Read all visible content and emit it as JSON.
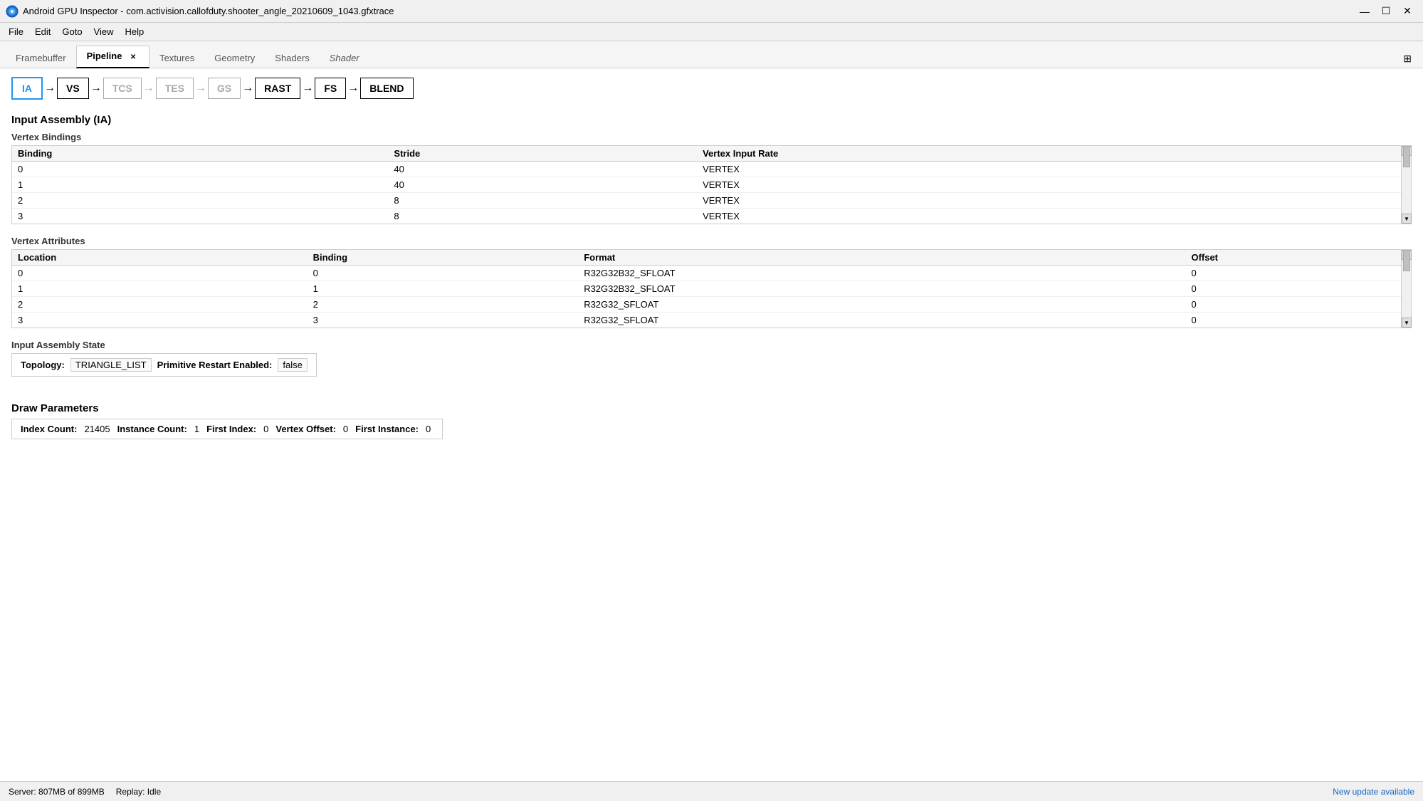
{
  "titleBar": {
    "title": "Android GPU Inspector - com.activision.callofduty.shooter_angle_20210609_1043.gfxtrace",
    "minimizeLabel": "—",
    "maximizeLabel": "☐",
    "closeLabel": "✕"
  },
  "menuBar": {
    "items": [
      "File",
      "Edit",
      "Goto",
      "View",
      "Help"
    ]
  },
  "tabs": [
    {
      "id": "framebuffer",
      "label": "Framebuffer",
      "active": false,
      "closeable": false
    },
    {
      "id": "pipeline",
      "label": "Pipeline",
      "active": true,
      "closeable": true
    },
    {
      "id": "textures",
      "label": "Textures",
      "active": false,
      "closeable": false
    },
    {
      "id": "geometry",
      "label": "Geometry",
      "active": false,
      "closeable": false
    },
    {
      "id": "shaders",
      "label": "Shaders",
      "active": false,
      "closeable": false
    },
    {
      "id": "shader",
      "label": "Shader",
      "active": false,
      "closeable": false,
      "italic": true
    }
  ],
  "pipeline": {
    "stages": [
      {
        "id": "ia",
        "label": "IA",
        "state": "active"
      },
      {
        "id": "vs",
        "label": "VS",
        "state": "normal"
      },
      {
        "id": "tcs",
        "label": "TCS",
        "state": "disabled"
      },
      {
        "id": "tes",
        "label": "TES",
        "state": "disabled"
      },
      {
        "id": "gs",
        "label": "GS",
        "state": "disabled"
      },
      {
        "id": "rast",
        "label": "RAST",
        "state": "normal"
      },
      {
        "id": "fs",
        "label": "FS",
        "state": "normal"
      },
      {
        "id": "blend",
        "label": "BLEND",
        "state": "normal"
      }
    ]
  },
  "inputAssembly": {
    "title": "Input Assembly (IA)",
    "vertexBindings": {
      "title": "Vertex Bindings",
      "columns": [
        "Binding",
        "Stride",
        "Vertex Input Rate"
      ],
      "rows": [
        [
          "0",
          "40",
          "VERTEX"
        ],
        [
          "1",
          "40",
          "VERTEX"
        ],
        [
          "2",
          "8",
          "VERTEX"
        ],
        [
          "3",
          "8",
          "VERTEX"
        ]
      ]
    },
    "vertexAttributes": {
      "title": "Vertex Attributes",
      "columns": [
        "Location",
        "Binding",
        "Format",
        "Offset"
      ],
      "rows": [
        [
          "0",
          "0",
          "R32G32B32_SFLOAT",
          "0"
        ],
        [
          "1",
          "1",
          "R32G32B32_SFLOAT",
          "0"
        ],
        [
          "2",
          "2",
          "R32G32_SFLOAT",
          "0"
        ],
        [
          "3",
          "3",
          "R32G32_SFLOAT",
          "0"
        ]
      ]
    },
    "assemblyState": {
      "title": "Input Assembly State",
      "topologyLabel": "Topology:",
      "topologyValue": "TRIANGLE_LIST",
      "primitiveRestartLabel": "Primitive Restart Enabled:",
      "primitiveRestartValue": "false"
    }
  },
  "drawParameters": {
    "title": "Draw Parameters",
    "indexCountLabel": "Index Count:",
    "indexCountValue": "21405",
    "instanceCountLabel": "Instance Count:",
    "instanceCountValue": "1",
    "firstIndexLabel": "First Index:",
    "firstIndexValue": "0",
    "vertexOffsetLabel": "Vertex Offset:",
    "vertexOffsetValue": "0",
    "firstInstanceLabel": "First Instance:",
    "firstInstanceValue": "0"
  },
  "statusBar": {
    "serverLabel": "Server:",
    "serverValue": "807MB of 899MB",
    "replayLabel": "Replay:",
    "replayValue": "Idle",
    "updateText": "New update available"
  }
}
